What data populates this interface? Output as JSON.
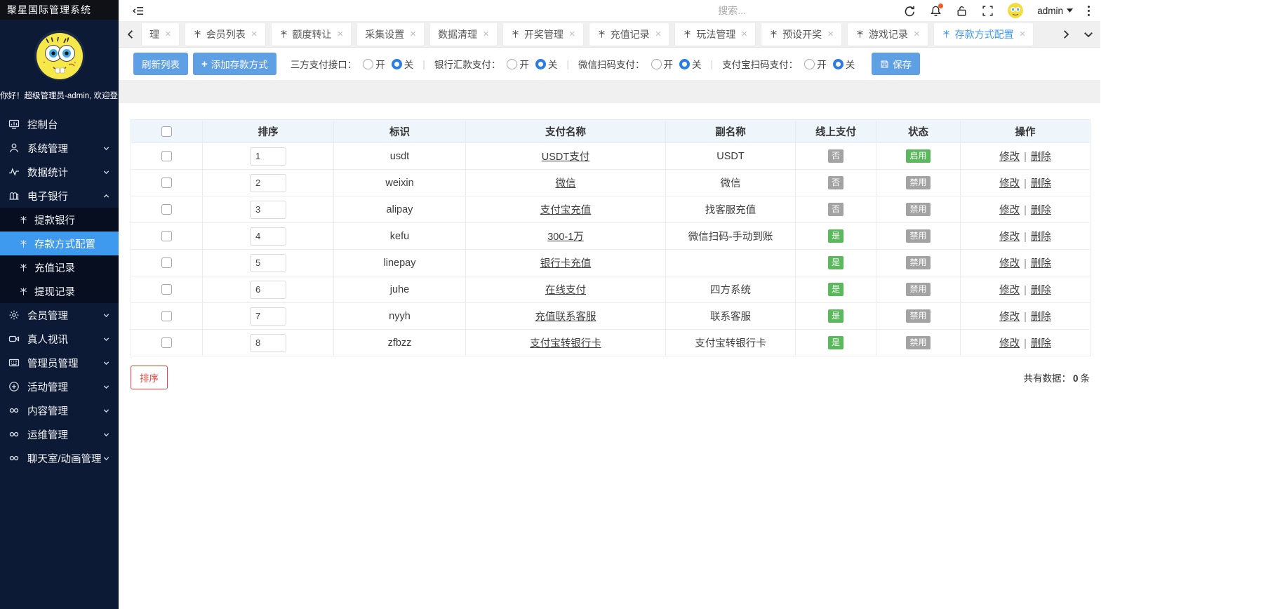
{
  "app": {
    "title": "聚星国际管理系统"
  },
  "topbar": {
    "search_placeholder": "搜索...",
    "username": "admin"
  },
  "sidebar": {
    "greeting": "你好！超级管理员-admin, 欢迎登录",
    "items": [
      {
        "id": "console",
        "icon": "dashboard",
        "label": "控制台"
      },
      {
        "id": "system-manage",
        "icon": "user",
        "label": "系统管理",
        "arrow": "down"
      },
      {
        "id": "data-stats",
        "icon": "activity",
        "label": "数据统计",
        "arrow": "down"
      },
      {
        "id": "e-bank",
        "icon": "bank",
        "label": "电子银行",
        "arrow": "up",
        "children": [
          {
            "id": "withdraw-bank",
            "label": "提款银行"
          },
          {
            "id": "deposit-method-config",
            "label": "存款方式配置",
            "active": true
          },
          {
            "id": "recharge-records",
            "label": "充值记录"
          },
          {
            "id": "withdraw-records",
            "label": "提现记录"
          }
        ]
      },
      {
        "id": "member-manage",
        "icon": "gear",
        "label": "会员管理",
        "arrow": "down"
      },
      {
        "id": "live-video",
        "icon": "video",
        "label": "真人视讯",
        "arrow": "down"
      },
      {
        "id": "admin-manage",
        "icon": "card",
        "label": "管理员管理",
        "arrow": "down"
      },
      {
        "id": "activity-manage",
        "icon": "plus-circle",
        "label": "活动管理",
        "arrow": "down"
      },
      {
        "id": "content-manage",
        "icon": "link",
        "label": "内容管理",
        "arrow": "down"
      },
      {
        "id": "ops-manage",
        "icon": "link",
        "label": "运维管理",
        "arrow": "down"
      },
      {
        "id": "chatroom-manage",
        "icon": "link",
        "label": "聊天室/动画管理",
        "arrow": "down"
      }
    ]
  },
  "tabs": [
    {
      "id": "li",
      "label": "理",
      "tree_icon": false
    },
    {
      "id": "member-list",
      "label": "会员列表",
      "tree_icon": true
    },
    {
      "id": "quota-transfer",
      "label": "额度转让",
      "tree_icon": true
    },
    {
      "id": "collect-settings",
      "label": "采集设置",
      "tree_icon": false
    },
    {
      "id": "data-cleanup",
      "label": "数据清理",
      "tree_icon": false
    },
    {
      "id": "lottery-manage",
      "label": "开奖管理",
      "tree_icon": true
    },
    {
      "id": "recharge-records",
      "label": "充值记录",
      "tree_icon": true
    },
    {
      "id": "play-manage",
      "label": "玩法管理",
      "tree_icon": true
    },
    {
      "id": "preset-lottery",
      "label": "预设开奖",
      "tree_icon": true
    },
    {
      "id": "game-records",
      "label": "游戏记录",
      "tree_icon": true
    },
    {
      "id": "deposit-method-config",
      "label": "存款方式配置",
      "tree_icon": true,
      "active": true
    }
  ],
  "toolbar": {
    "refresh_label": "刷新列表",
    "add_label": "添加存款方式",
    "save_label": "保存",
    "switches": [
      {
        "id": "third-party-pay",
        "label": "三方支付接口：",
        "on_label": "开",
        "off_label": "关",
        "selected": "off"
      },
      {
        "id": "bank-remit-pay",
        "label": "银行汇款支付：",
        "on_label": "开",
        "off_label": "关",
        "selected": "off"
      },
      {
        "id": "wechat-scan-pay",
        "label": "微信扫码支付：",
        "on_label": "开",
        "off_label": "关",
        "selected": "off"
      },
      {
        "id": "alipay-scan-pay",
        "label": "支付宝扫码支付：",
        "on_label": "开",
        "off_label": "关",
        "selected": "off"
      }
    ]
  },
  "table": {
    "headers": [
      "排序",
      "标识",
      "支付名称",
      "副名称",
      "线上支付",
      "状态",
      "操作"
    ],
    "edit_label": "修改",
    "delete_label": "删除",
    "rows": [
      {
        "order": "1",
        "code": "usdt",
        "pay_name": "USDT支付",
        "sub_name": "USDT",
        "online": "否",
        "status": "启用"
      },
      {
        "order": "2",
        "code": "weixin",
        "pay_name": "微信",
        "sub_name": "微信",
        "online": "否",
        "status": "禁用"
      },
      {
        "order": "3",
        "code": "alipay",
        "pay_name": "支付宝充值",
        "sub_name": "找客服充值",
        "online": "否",
        "status": "禁用"
      },
      {
        "order": "4",
        "code": "kefu",
        "pay_name": "300-1万",
        "sub_name": "微信扫码-手动到账",
        "online": "是",
        "status": "禁用"
      },
      {
        "order": "5",
        "code": "linepay",
        "pay_name": "银行卡充值",
        "sub_name": "",
        "online": "是",
        "status": "禁用"
      },
      {
        "order": "6",
        "code": "juhe",
        "pay_name": "在线支付",
        "sub_name": "四方系统",
        "online": "是",
        "status": "禁用"
      },
      {
        "order": "7",
        "code": "nyyh",
        "pay_name": "充值联系客服",
        "sub_name": "联系客服",
        "online": "是",
        "status": "禁用"
      },
      {
        "order": "8",
        "code": "zfbzz",
        "pay_name": "支付宝转银行卡",
        "sub_name": "支付宝转银行卡",
        "online": "是",
        "status": "禁用"
      }
    ]
  },
  "footer": {
    "sort_label": "排序",
    "total_prefix": "共有数据：",
    "total_count": "0",
    "total_suffix": "条"
  },
  "colors": {
    "accent_blue": "#3e9aef",
    "button_blue": "#5f9fe3",
    "radio_blue": "#2a7ce8",
    "badge_green": "#5cb85c",
    "badge_gray": "#a3a3a3",
    "danger_red": "#e2453c",
    "sidebar_bg": "#0c1a36",
    "submenu_bg": "#060e1f",
    "table_header_bg": "#eef6fc"
  }
}
